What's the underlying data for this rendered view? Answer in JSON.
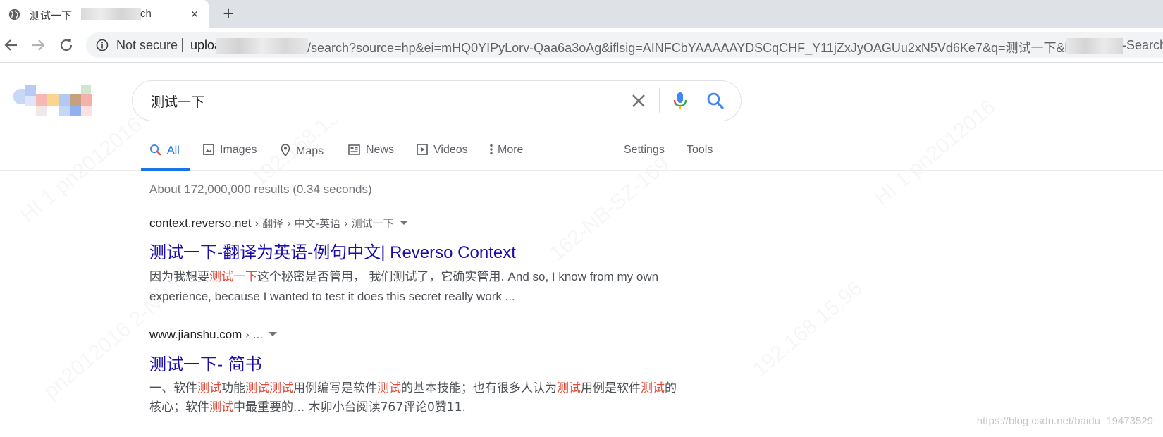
{
  "browser": {
    "tab": {
      "title_start": "测试一下",
      "title_end": "ch",
      "close_label": "×",
      "new_tab_label": "+"
    },
    "omnibox": {
      "security_label": "Not secure",
      "url_start": "uploa",
      "url_middle": "/search?source=hp&ei=mHQ0YIPyLorv-Qaa6a3oAg&iflsig=AINFCbYAAAAAYDSCqCHF_Y11jZxJyOAGUu2xN5Vd6Ke7&q=测试一下&btnK",
      "url_end": "-Search"
    }
  },
  "search": {
    "query": "测试一下"
  },
  "nav": {
    "all": "All",
    "images": "Images",
    "maps": "Maps",
    "news": "News",
    "videos": "Videos",
    "more": "More",
    "settings": "Settings",
    "tools": "Tools"
  },
  "stats": "About 172,000,000 results (0.34 seconds)",
  "results": [
    {
      "domain": "context.reverso.net",
      "breadcrumb": " › 翻译 › 中文-英语 › 测试一下",
      "title_cn": "测试一下-翻译为英语-例句中文",
      "title_en": "| Reverso Context",
      "snippet_1": "因为我想要",
      "snippet_2": "测试一下",
      "snippet_3": "这个秘密是否管用， 我们测试了，它确实管用.",
      "snippet_4": " And so, I know from my own experience, because I wanted to test it does this secret really work ..."
    },
    {
      "domain": "www.jianshu.com",
      "breadcrumb": " › ...",
      "title_cn": "测试一下- 简书",
      "snippet_parts": [
        {
          "t": "一、软件",
          "hl": false
        },
        {
          "t": "测试",
          "hl": true
        },
        {
          "t": "功能",
          "hl": false
        },
        {
          "t": "测试测试",
          "hl": true
        },
        {
          "t": "用例编写是软件",
          "hl": false
        },
        {
          "t": "测试",
          "hl": true
        },
        {
          "t": "的基本技能；也有很多人认为",
          "hl": false
        },
        {
          "t": "测试",
          "hl": true
        },
        {
          "t": "用例是软件",
          "hl": false
        },
        {
          "t": "测试",
          "hl": true
        },
        {
          "t": "的核心；软件",
          "hl": false
        },
        {
          "t": "测试",
          "hl": true
        },
        {
          "t": "中最重要的... 木卯小台阅读767评论0赞11.",
          "hl": false
        }
      ]
    }
  ],
  "watermark": "https://blog.csdn.net/baidu_19473529",
  "colors": {
    "link": "#1a0dab",
    "accent": "#1a73e8",
    "highlight": "#dd4b39"
  }
}
